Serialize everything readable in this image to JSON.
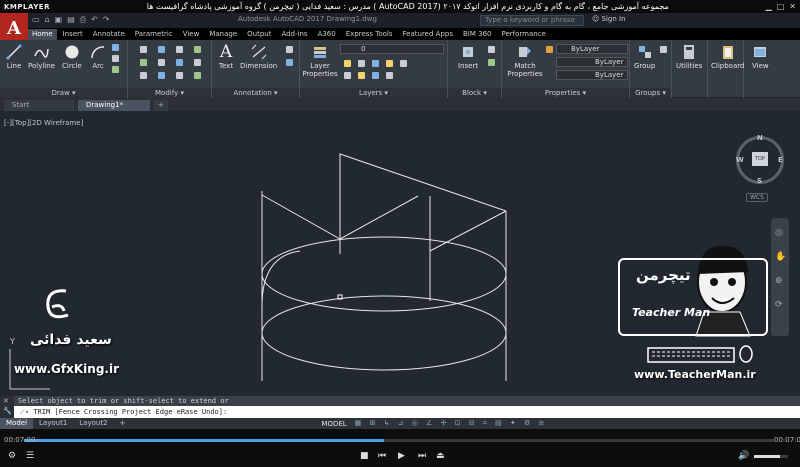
{
  "player": {
    "brand": "KMPLAYER",
    "title": "مجموعه آموزشی جامع ، گام به گام و کاربردی نرم افزار اتوکد ۲۰۱۷ (AutoCAD 2017 ) مدرس : سعید فدایی ( تیچرمن ) گروه آموزشی پادشاه گرافیست ها",
    "time_current": "00:07:00",
    "time_total": "00:07:03",
    "progress": 0.48
  },
  "acad": {
    "app_letter": "A",
    "doc_title": "Autodesk AutoCAD 2017   Drawing1.dwg",
    "search_placeholder": "Type a keyword or phrase",
    "sign_in": "Sign In",
    "tabs": [
      "Home",
      "Insert",
      "Annotate",
      "Parametric",
      "View",
      "Manage",
      "Output",
      "Add-ins",
      "A360",
      "Express Tools",
      "Featured Apps",
      "BIM 360",
      "Performance"
    ],
    "active_tab": "Home"
  },
  "ribbon": {
    "draw": {
      "label": "Draw",
      "tools": [
        "Line",
        "Polyline",
        "Circle",
        "Arc"
      ]
    },
    "modify": {
      "label": "Modify"
    },
    "annotation": {
      "label": "Annotation",
      "tools": [
        "Text",
        "Dimension"
      ]
    },
    "layers": {
      "label": "Layers",
      "tool": "Layer Properties",
      "current_layer": "0"
    },
    "block": {
      "label": "Block",
      "tool": "Insert"
    },
    "properties": {
      "label": "Properties",
      "tool": "Match Properties",
      "color": "ByLayer",
      "linetype": "ByLayer",
      "lineweight": "ByLayer"
    },
    "groups": {
      "label": "Groups",
      "tool": "Group"
    },
    "utilities": "Utilities",
    "clipboard": "Clipboard",
    "view": "View"
  },
  "doc_tabs": [
    "Start",
    "Drawing1*"
  ],
  "viewport": {
    "label": "[-][Top][2D Wireframe]",
    "cube_top": "TOP",
    "compass": {
      "n": "N",
      "s": "S",
      "e": "E",
      "w": "W"
    },
    "wcs": "WCS",
    "ucs_y": "Y"
  },
  "command": {
    "history": "Select object to trim or shift-select to extend or",
    "prompt": "TRIM [Fence Crossing Project Edge eRase Undo]:"
  },
  "layout_tabs": [
    "Model",
    "Layout1",
    "Layout2"
  ],
  "status": {
    "model": "MODEL"
  },
  "watermark": {
    "name_fa": "سعید فدائی",
    "url": "www.GfxKing.ir",
    "teacher_fa": "تیچرمن",
    "teacher_brand": "Teacher Man",
    "teacher_url": "www.TeacherMan.ir"
  },
  "colors": {
    "accent": "#b3261e",
    "canvas": "#212830",
    "ribbon": "#353b43",
    "progress": "#47a0e8"
  }
}
